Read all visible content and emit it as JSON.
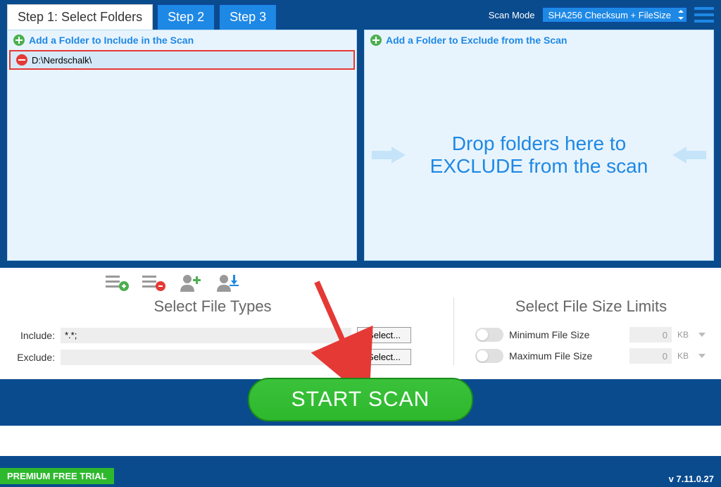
{
  "header": {
    "tabs": [
      {
        "label": "Step 1: Select Folders",
        "active": true
      },
      {
        "label": "Step 2",
        "active": false
      },
      {
        "label": "Step 3",
        "active": false
      }
    ],
    "scan_mode_label": "Scan Mode",
    "scan_mode_value": "SHA256 Checksum + FileSize"
  },
  "include_panel": {
    "header": "Add a Folder to Include in the Scan",
    "items": [
      {
        "path": "D:\\Nerdschalk\\"
      }
    ]
  },
  "exclude_panel": {
    "header": "Add a Folder to Exclude from the Scan",
    "drop_text": "Drop folders here to EXCLUDE from the scan"
  },
  "file_types": {
    "title": "Select File Types",
    "include_label": "Include:",
    "include_value": "*.*;",
    "exclude_label": "Exclude:",
    "exclude_value": "",
    "select_button": "Select..."
  },
  "file_size": {
    "title": "Select File Size Limits",
    "min_label": "Minimum File Size",
    "min_value": "0",
    "max_label": "Maximum File Size",
    "max_value": "0",
    "unit": "KB"
  },
  "start_scan_label": "START SCAN",
  "footer": {
    "trial": "PREMIUM FREE TRIAL",
    "version": "v 7.11.0.27"
  }
}
